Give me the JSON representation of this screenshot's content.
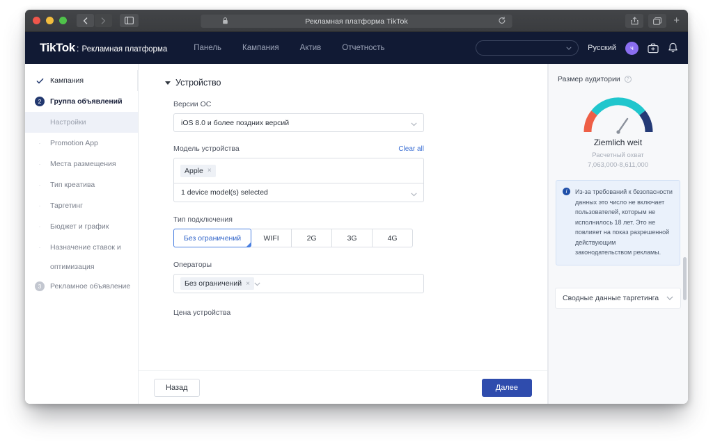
{
  "browser": {
    "title": "Рекламная платформа TikTok",
    "lock_icon": "lock-icon",
    "reload_icon": "reload-icon",
    "back_icon": "back-chevron-icon",
    "forward_icon": "forward-chevron-icon",
    "sidebar_icon": "sidebar-toggle-icon",
    "share_icon": "share-icon",
    "tabs_icon": "tabs-overview-icon",
    "new_tab_label": "+"
  },
  "appheader": {
    "brand_main": "TikTok",
    "brand_sep": ":",
    "brand_sub": "Рекламная платформа",
    "nav": [
      {
        "label": "Панель"
      },
      {
        "label": "Кампания"
      },
      {
        "label": "Актив"
      },
      {
        "label": "Отчетность"
      }
    ],
    "account_select_value": "",
    "language": "Русский",
    "avatar_initial": "ч",
    "briefcase_icon": "briefcase-icon",
    "bell_icon": "bell-icon"
  },
  "sidebar": {
    "items": [
      {
        "label": "Кампания",
        "marker": "check",
        "state": "done"
      },
      {
        "label": "Группа объявлений",
        "marker": "2",
        "state": "current"
      },
      {
        "label": "Настройки",
        "marker": "none",
        "state": "active"
      },
      {
        "label": "Promotion App",
        "marker": "dot",
        "state": "idle"
      },
      {
        "label": "Места размещения",
        "marker": "dot",
        "state": "idle"
      },
      {
        "label": "Тип креатива",
        "marker": "dot",
        "state": "idle"
      },
      {
        "label": "Таргетинг",
        "marker": "dot",
        "state": "idle"
      },
      {
        "label": "Бюджет и график",
        "marker": "dot",
        "state": "idle"
      },
      {
        "label": "Назначение ставок и",
        "marker": "dot",
        "state": "idle"
      },
      {
        "label": "оптимизация",
        "marker": "none",
        "state": "cont"
      },
      {
        "label": "Рекламное объявление",
        "marker": "3",
        "state": "idle"
      }
    ]
  },
  "main": {
    "section_title": "Устройство",
    "os_versions": {
      "label": "Версии ОС",
      "value": "iOS 8.0 и более поздних версий"
    },
    "device_model": {
      "label": "Модель устройства",
      "clear_all": "Clear all",
      "tags": [
        {
          "label": "Apple",
          "remove": "×"
        }
      ],
      "value": "1 device model(s) selected"
    },
    "connection_type": {
      "label": "Тип подключения",
      "options": [
        {
          "label": "Без ограничений",
          "selected": true
        },
        {
          "label": "WIFI",
          "selected": false
        },
        {
          "label": "2G",
          "selected": false
        },
        {
          "label": "3G",
          "selected": false
        },
        {
          "label": "4G",
          "selected": false
        }
      ]
    },
    "carriers": {
      "label": "Операторы",
      "tags": [
        {
          "label": "Без ограничений",
          "remove": "×"
        }
      ]
    },
    "device_price": {
      "label": "Цена устройства"
    },
    "footer": {
      "back_label": "Назад",
      "next_label": "Далее"
    }
  },
  "rightpanel": {
    "title": "Размер аудитории",
    "help_icon": "question-mark-icon",
    "gauge": {
      "status": "Ziemlich weit",
      "reach_label": "Расчетный охват",
      "reach_value": "7,063,000-8,611,000",
      "colors": {
        "left": "#ee5f46",
        "arc": "#1fc6cf",
        "arc2": "#35d0c6",
        "right": "#243a76",
        "needle": "#8a909b"
      }
    },
    "info": {
      "icon": "info-icon",
      "text": "Из-за требований к безопасности данных это число не включает пользователей, которым не исполнилось 18 лет. Это не повлияет на показ разрешенной действующим законодательством рекламы."
    },
    "summary": {
      "label": "Сводные данные таргетинга",
      "chevron": "chevron-down-icon"
    }
  },
  "colors": {
    "brand_navy": "#111a34",
    "primary_blue": "#2f4cad",
    "accent_link": "#3b6fd4",
    "segment_active_border": "#4a7fe0"
  }
}
